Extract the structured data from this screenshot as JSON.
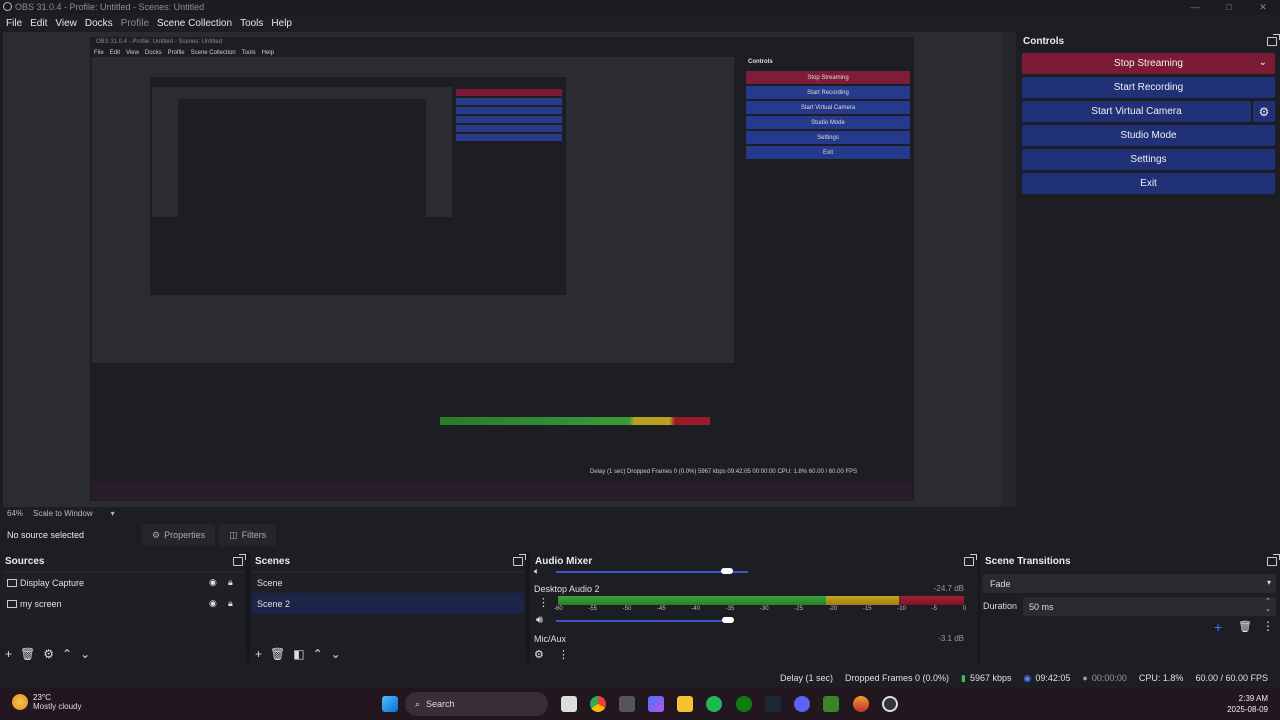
{
  "window": {
    "title": "OBS 31.0.4 - Profile: Untitled - Scenes: Untitled",
    "min": "—",
    "max": "□",
    "close": "✕"
  },
  "menu": [
    "File",
    "Edit",
    "View",
    "Docks",
    "Profile",
    "Scene Collection",
    "Tools",
    "Help"
  ],
  "nested": {
    "title": "OBS 31.0.4 - Profile: Untitled - Scenes: Untitled",
    "controls_label": "Controls",
    "buttons": [
      "Stop Streaming",
      "Start Recording",
      "Start Virtual Camera",
      "Studio Mode",
      "Settings",
      "Exit"
    ],
    "status": "Delay (1 sec)   Dropped Frames 0 (0.0%)   5967 kbps   09:42:05   00:00:00   CPU: 1.8%   60.00 / 60.00 FPS"
  },
  "controls": {
    "title": "Controls",
    "stop_streaming": "Stop Streaming",
    "start_recording": "Start Recording",
    "start_virtual_camera": "Start Virtual Camera",
    "studio_mode": "Studio Mode",
    "settings": "Settings",
    "exit": "Exit"
  },
  "scale": {
    "zoom": "64%",
    "mode": "Scale to Window"
  },
  "source_bar": {
    "no_source": "No source selected",
    "properties": "Properties",
    "filters": "Filters"
  },
  "sources": {
    "title": "Sources",
    "items": [
      "Display Capture",
      "my screen"
    ]
  },
  "scenes": {
    "title": "Scenes",
    "items": [
      "Scene",
      "Scene 2"
    ]
  },
  "mixer": {
    "title": "Audio Mixer",
    "desktop": {
      "name": "Desktop Audio 2",
      "db": "-24.7 dB"
    },
    "mic": {
      "name": "Mic/Aux",
      "db": "-3.1 dB"
    },
    "ticks": [
      "-60",
      "-55",
      "-50",
      "-45",
      "-40",
      "-35",
      "-30",
      "-25",
      "-20",
      "-15",
      "-10",
      "-5",
      "0"
    ]
  },
  "transitions": {
    "title": "Scene Transitions",
    "selected": "Fade",
    "duration_label": "Duration",
    "duration_value": "50 ms"
  },
  "status": {
    "delay": "Delay (1 sec)",
    "dropped": "Dropped Frames 0 (0.0%)",
    "kbps": "5967 kbps",
    "stream_time": "09:42:05",
    "rec_time": "00:00:00",
    "cpu": "CPU: 1.8%",
    "fps": "60.00 / 60.00 FPS"
  },
  "taskbar": {
    "temp": "23°C",
    "weather": "Mostly cloudy",
    "search": "Search",
    "time": "2:39 AM",
    "date": "2025-08-09"
  },
  "colors": {
    "streaming": "#7b1b36",
    "button": "#213178",
    "selected_row": "#1c2547"
  }
}
